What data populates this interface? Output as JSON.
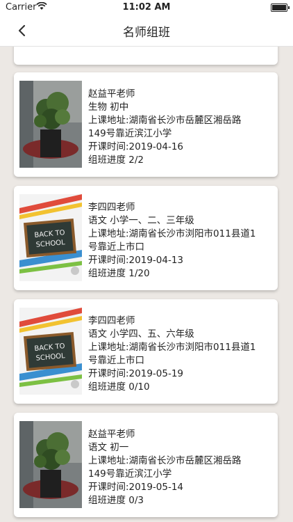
{
  "status": {
    "carrier": "Carrier",
    "time": "11:02 AM"
  },
  "nav": {
    "title": "名师组班"
  },
  "cards": [
    {
      "image": "plant-photo",
      "teacher": "赵益平老师",
      "subject": "生物 初中",
      "address_1": "上课地址:湖南省长沙市岳麓区湘岳路",
      "address_2": "149号靠近滨江小学",
      "start": "开课时间:2019-04-16",
      "progress": "组班进度 2/2"
    },
    {
      "image": "back-to-school-chalkboard",
      "teacher": "李四四老师",
      "subject": "语文 小学一、二、三年级",
      "address_1": "上课地址:湖南省长沙市浏阳市011县道1",
      "address_2": "号靠近上市口",
      "start": "开课时间:2019-04-13",
      "progress": "组班进度 1/20"
    },
    {
      "image": "back-to-school-chalkboard",
      "teacher": "李四四老师",
      "subject": "语文 小学四、五、六年级",
      "address_1": "上课地址:湖南省长沙市浏阳市011县道1",
      "address_2": "号靠近上市口",
      "start": "开课时间:2019-05-19",
      "progress": "组班进度 0/10"
    },
    {
      "image": "plant-photo",
      "teacher": "赵益平老师",
      "subject": "语文 初一",
      "address_1": "上课地址:湖南省长沙市岳麓区湘岳路",
      "address_2": "149号靠近滨江小学",
      "start": "开课时间:2019-05-14",
      "progress": "组班进度 0/3"
    }
  ],
  "chalkboard_text": {
    "line1": "BACK TO",
    "line2": "SCHOOL"
  }
}
